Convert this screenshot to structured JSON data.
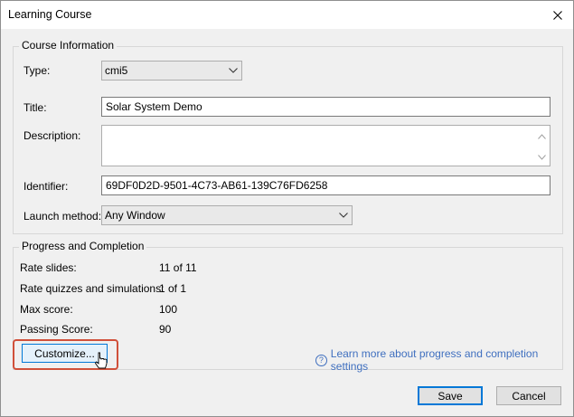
{
  "window": {
    "title": "Learning Course",
    "close_icon": "close-icon"
  },
  "course_info": {
    "legend": "Course Information",
    "type_label": "Type:",
    "type_value": "cmi5",
    "title_label": "Title:",
    "title_value": "Solar System Demo",
    "description_label": "Description:",
    "description_value": "",
    "identifier_label": "Identifier:",
    "identifier_value": "69DF0D2D-9501-4C73-AB61-139C76FD6258",
    "launch_label": "Launch method:",
    "launch_value": "Any Window"
  },
  "progress": {
    "legend": "Progress and Completion",
    "rows": [
      {
        "label": "Rate slides:",
        "value": "11 of 11"
      },
      {
        "label": "Rate quizzes and simulations:",
        "value": "1 of 1"
      },
      {
        "label": "Max score:",
        "value": "100"
      },
      {
        "label": "Passing Score:",
        "value": "90"
      }
    ],
    "customize_label": "Customize...",
    "help_link": "Learn more about progress and completion settings",
    "help_icon": "question-circle-icon"
  },
  "footer": {
    "save_label": "Save",
    "cancel_label": "Cancel"
  },
  "colors": {
    "accent": "#0078d7",
    "highlight": "#d0503a",
    "link": "#3f6fbf"
  }
}
